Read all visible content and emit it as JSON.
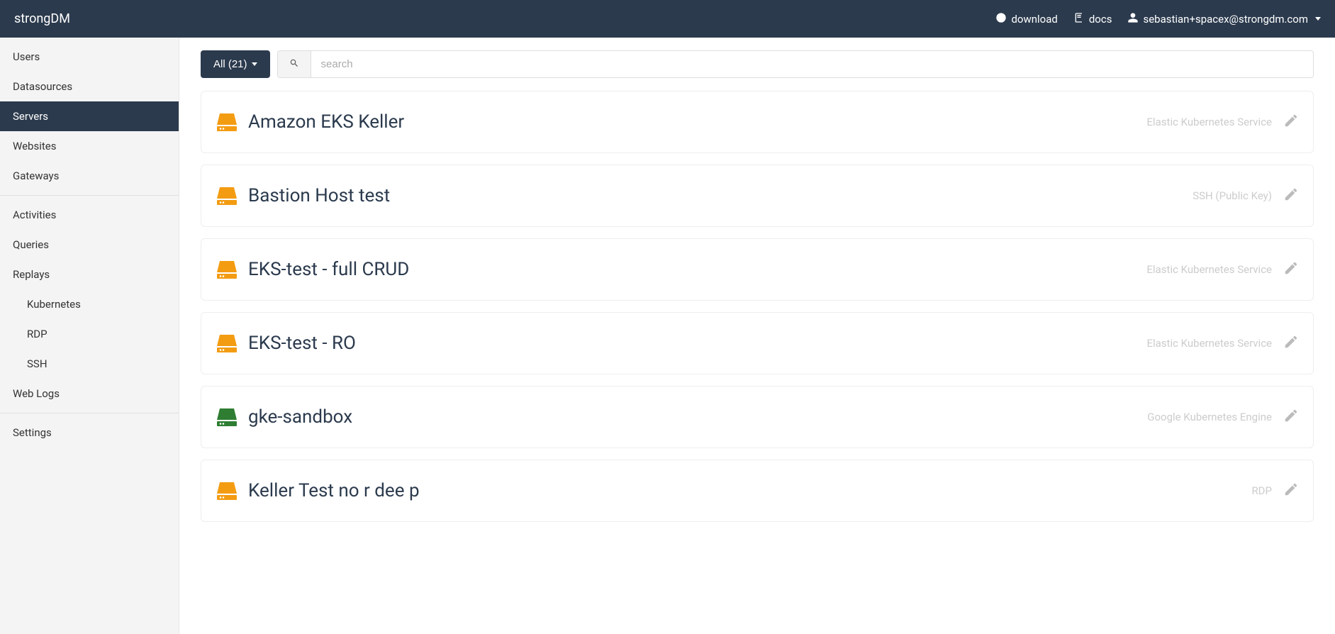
{
  "header": {
    "brand": "strongDM",
    "download_label": "download",
    "docs_label": "docs",
    "user_email": "sebastian+spacex@strongdm.com"
  },
  "sidebar": {
    "items": [
      {
        "label": "Users",
        "active": false
      },
      {
        "label": "Datasources",
        "active": false
      },
      {
        "label": "Servers",
        "active": true
      },
      {
        "label": "Websites",
        "active": false
      },
      {
        "label": "Gateways",
        "active": false
      }
    ],
    "items2": [
      {
        "label": "Activities"
      },
      {
        "label": "Queries"
      },
      {
        "label": "Replays"
      }
    ],
    "subitems": [
      {
        "label": "Kubernetes"
      },
      {
        "label": "RDP"
      },
      {
        "label": "SSH"
      }
    ],
    "items3": [
      {
        "label": "Web Logs"
      }
    ],
    "items4": [
      {
        "label": "Settings"
      }
    ]
  },
  "toolbar": {
    "filter_label": "All (21)",
    "search_placeholder": "search"
  },
  "servers": [
    {
      "name": "Amazon EKS Keller",
      "type": "Elastic Kubernetes Service",
      "color": "orange"
    },
    {
      "name": "Bastion Host test",
      "type": "SSH (Public Key)",
      "color": "orange"
    },
    {
      "name": "EKS-test - full CRUD",
      "type": "Elastic Kubernetes Service",
      "color": "orange"
    },
    {
      "name": "EKS-test - RO",
      "type": "Elastic Kubernetes Service",
      "color": "orange"
    },
    {
      "name": "gke-sandbox",
      "type": "Google Kubernetes Engine",
      "color": "green"
    },
    {
      "name": "Keller Test no r dee p",
      "type": "RDP",
      "color": "orange"
    }
  ]
}
